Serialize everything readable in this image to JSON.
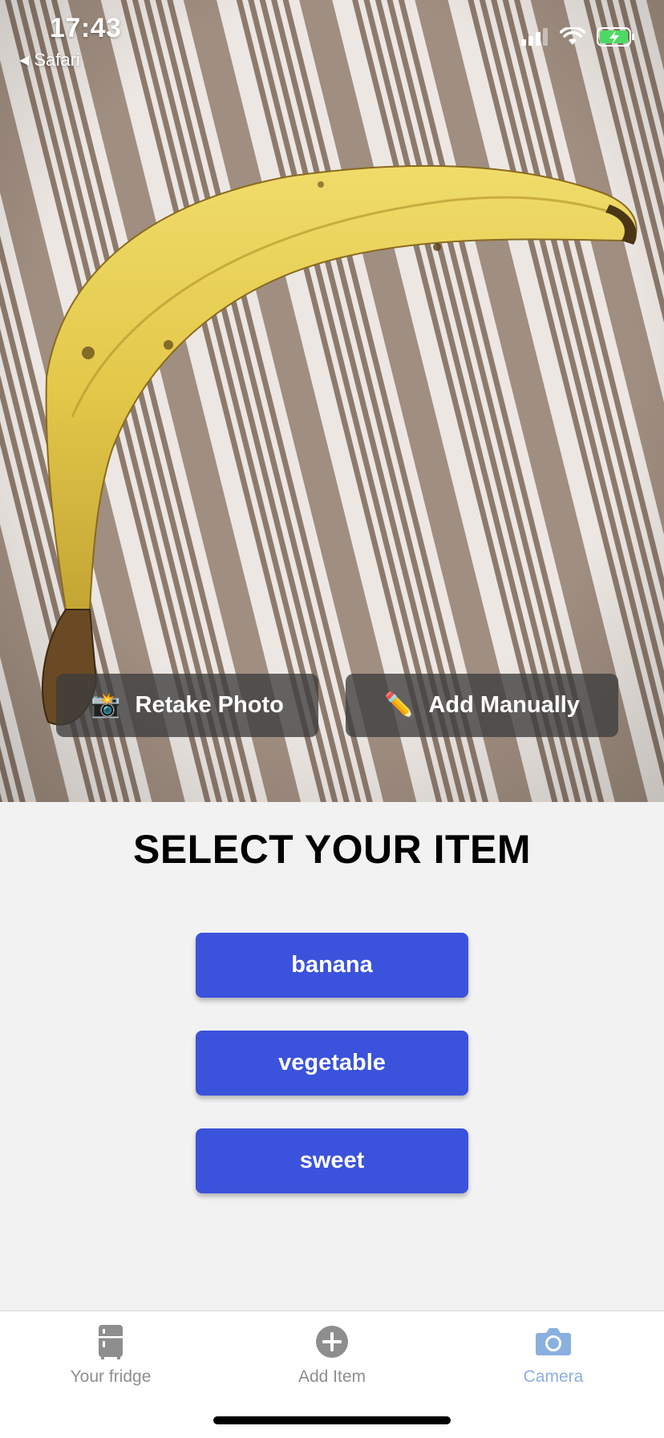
{
  "status_bar": {
    "time": "17:43",
    "back_app": "Safari",
    "signal_icon": "cellular-signal-icon",
    "wifi_icon": "wifi-icon",
    "battery_icon": "battery-charging-icon"
  },
  "photo": {
    "subject": "banana-on-striped-cloth"
  },
  "photo_actions": {
    "retake_label": "Retake Photo",
    "retake_emoji": "📸",
    "manual_label": "Add Manually",
    "manual_emoji": "✏️"
  },
  "main": {
    "title": "SELECT YOUR ITEM",
    "options": [
      "banana",
      "vegetable",
      "sweet"
    ]
  },
  "tabbar": {
    "tabs": [
      {
        "label": "Your fridge",
        "icon": "fridge-icon",
        "active": false
      },
      {
        "label": "Add Item",
        "icon": "plus-circle-icon",
        "active": false
      },
      {
        "label": "Camera",
        "icon": "camera-icon",
        "active": true
      }
    ]
  },
  "colors": {
    "accent": "#3b52dc",
    "active_tab": "#8ab0e0",
    "inactive_tab": "#8e8e8e",
    "background": "#f2f2f2"
  }
}
